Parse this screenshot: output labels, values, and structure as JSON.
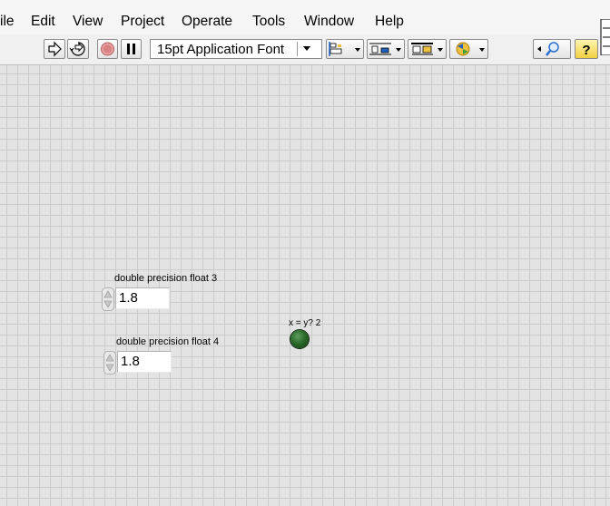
{
  "menu": {
    "items": [
      "ile",
      "Edit",
      "View",
      "Project",
      "Operate",
      "Tools",
      "Window",
      "Help"
    ]
  },
  "toolbar": {
    "font_select_value": "15pt Application Font",
    "buttons": [
      "run-arrow-icon",
      "run-continuously-icon",
      "abort-execution-icon",
      "pause-icon",
      "align-objects-icon",
      "distribute-objects-icon",
      "resize-objects-icon",
      "reorder-icon",
      "search-icon",
      "context-help-icon"
    ]
  },
  "panel": {
    "control1": {
      "label": "double precision float 3",
      "value": "1.8"
    },
    "control2": {
      "label": "double precision float 4",
      "value": "1.8"
    },
    "indicator": {
      "label": "x = y? 2",
      "state": "off",
      "color": "#2b6a2b"
    }
  },
  "colors": {
    "panel_bg": "#e3e3e3",
    "grid_line": "#cbcbcb"
  }
}
